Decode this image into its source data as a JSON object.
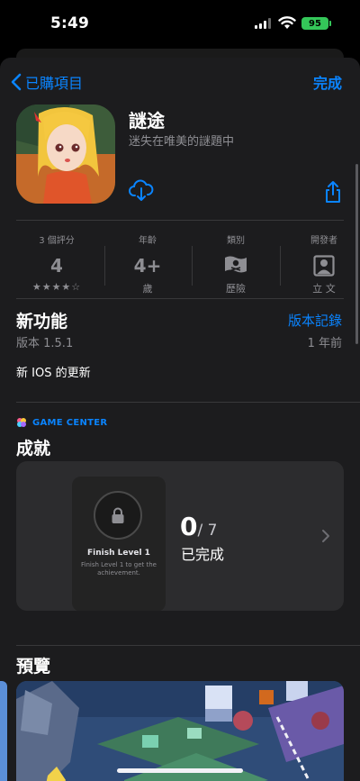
{
  "status_bar": {
    "time": "5:49",
    "battery": "95"
  },
  "nav": {
    "back_label": "已購項目",
    "done_label": "完成"
  },
  "app": {
    "title": "謎途",
    "subtitle": "迷失在唯美的謎題中"
  },
  "info": {
    "ratings": {
      "label": "3 個評分",
      "value": "4",
      "stars": "★★★★☆"
    },
    "age": {
      "label": "年齡",
      "value": "4+",
      "unit": "歲"
    },
    "category": {
      "label": "類別",
      "value": "歷險"
    },
    "developer": {
      "label": "開發者",
      "value": "立 文"
    }
  },
  "whats_new": {
    "title": "新功能",
    "history_link": "版本記錄",
    "version": "版本 1.5.1",
    "age": "1 年前",
    "notes": "新 IOS 的更新"
  },
  "game_center": {
    "badge": "GAME CENTER",
    "title": "成就",
    "achievement": {
      "name": "Finish Level 1",
      "description": "Finish Level 1 to get the achievement."
    },
    "count": "0",
    "total": "/ 7",
    "status": "已完成"
  },
  "preview": {
    "title": "預覽"
  },
  "colors": {
    "accent": "#0a84ff",
    "battery": "#34c759",
    "background": "#1c1c1e"
  }
}
